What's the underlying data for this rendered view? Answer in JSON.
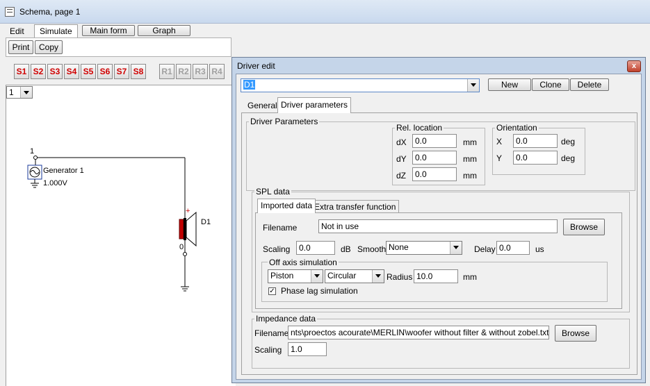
{
  "window": {
    "title": "Schema, page 1"
  },
  "menu": {
    "edit": "Edit",
    "simulate": "Simulate",
    "main_form": "Main form",
    "graph": "Graph"
  },
  "toolbar": {
    "print": "Print",
    "copy": "Copy",
    "s_buttons": [
      "S1",
      "S2",
      "S3",
      "S4",
      "S5",
      "S6",
      "S7",
      "S8"
    ],
    "r_buttons": [
      "R1",
      "R2",
      "R3",
      "R4"
    ],
    "accent_color": "#d00000"
  },
  "page_selector": {
    "value": "1"
  },
  "schematic": {
    "node_top": "1",
    "node_bottom": "0",
    "generator_label": "Generator 1",
    "generator_value": "1.000V",
    "driver_label": "D1",
    "plus": "+"
  },
  "dialog": {
    "title": "Driver edit",
    "close": "x",
    "driver_select": "D1",
    "new_btn": "New",
    "clone_btn": "Clone",
    "delete_btn": "Delete",
    "tabs": {
      "general": "General",
      "driver_params": "Driver parameters"
    },
    "driver_parameters_group": "Driver Parameters",
    "rel_location": {
      "title": "Rel. location",
      "dx_label": "dX",
      "dx": "0.0",
      "dy_label": "dY",
      "dy": "0.0",
      "dz_label": "dZ",
      "dz": "0.0",
      "unit": "mm"
    },
    "orientation": {
      "title": "Orientation",
      "x_label": "X",
      "x": "0.0",
      "y_label": "Y",
      "y": "0.0",
      "unit": "deg"
    },
    "spl": {
      "title": "SPL data",
      "tab_imported": "Imported data",
      "tab_extra": "Extra transfer function",
      "filename_label": "Filename",
      "filename": "Not in use",
      "browse": "Browse",
      "scaling_label": "Scaling",
      "scaling": "0.0",
      "scaling_unit": "dB",
      "smooth_label": "Smooth",
      "smooth": "None",
      "delay_label": "Delay",
      "delay": "0.0",
      "delay_unit": "us",
      "off_axis": {
        "title": "Off axis simulation",
        "model": "Piston",
        "shape": "Circular",
        "radius_label": "Radius",
        "radius": "10.0",
        "radius_unit": "mm",
        "phase_lag_label": "Phase lag simulation",
        "phase_lag_checked": true
      }
    },
    "impedance": {
      "title": "Impedance data",
      "filename_label": "Filename",
      "filename": "nts\\proectos acourate\\MERLIN\\woofer without filter & without zobel.txt",
      "browse": "Browse",
      "scaling_label": "Scaling",
      "scaling": "1.0"
    }
  }
}
